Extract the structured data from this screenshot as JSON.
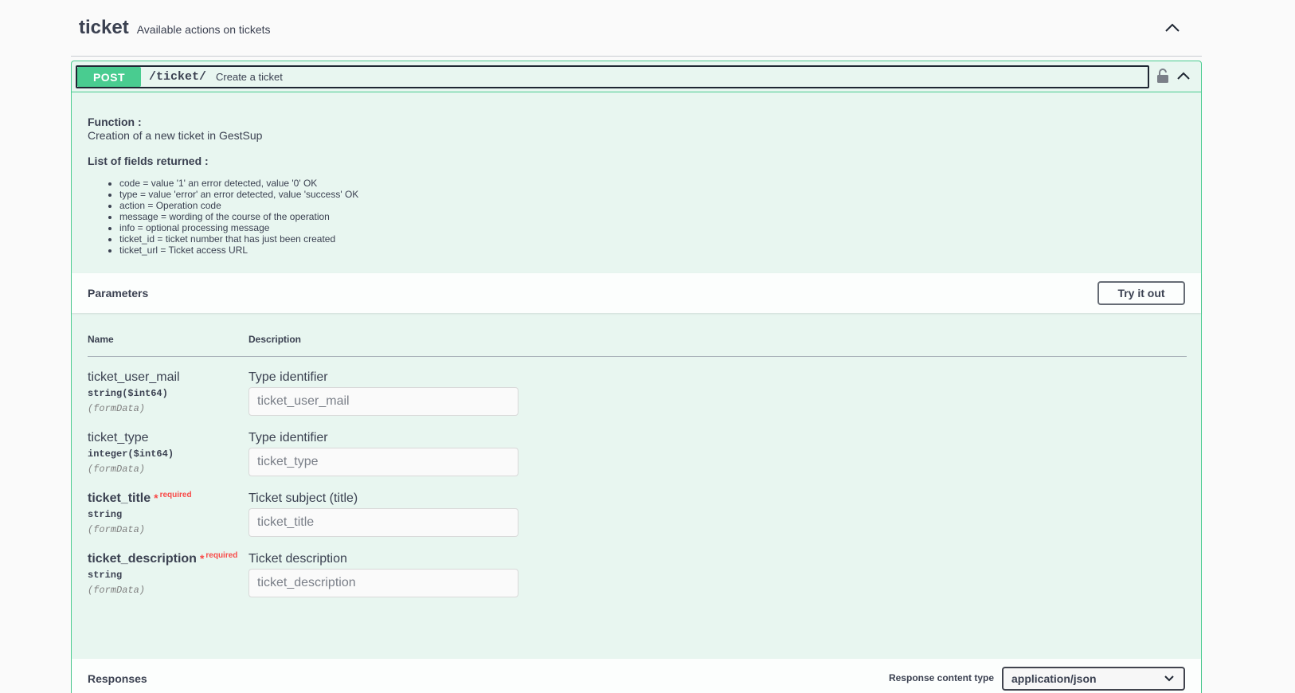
{
  "tag": {
    "name": "ticket",
    "description": "Available actions on tickets"
  },
  "operation": {
    "method": "POST",
    "path": "/ticket/",
    "summary": "Create a ticket",
    "function_label": "Function :",
    "function_text": "Creation of a new ticket in GestSup",
    "fields_heading": "List of fields returned :",
    "fields": [
      "code = value '1' an error detected, value '0' OK",
      "type = value 'error' an error detected, value 'success' OK",
      "action = Operation code",
      "message = wording of the course of the operation",
      "info = optional processing message",
      "ticket_id = ticket number that has just been created",
      "ticket_url = Ticket access URL"
    ]
  },
  "parameters": {
    "title": "Parameters",
    "try_label": "Try it out",
    "col_name": "Name",
    "col_description": "Description",
    "items": [
      {
        "name": "ticket_user_mail",
        "required": false,
        "type": "string",
        "format": "($int64)",
        "in": "(formData)",
        "description": "Type identifier",
        "placeholder": "ticket_user_mail"
      },
      {
        "name": "ticket_type",
        "required": false,
        "type": "integer",
        "format": "($int64)",
        "in": "(formData)",
        "description": "Type identifier",
        "placeholder": "ticket_type"
      },
      {
        "name": "ticket_title",
        "required": true,
        "type": "string",
        "format": "",
        "in": "(formData)",
        "description": "Ticket subject (title)",
        "placeholder": "ticket_title"
      },
      {
        "name": "ticket_description",
        "required": true,
        "type": "string",
        "format": "",
        "in": "(formData)",
        "description": "Ticket description",
        "placeholder": "ticket_description"
      }
    ],
    "required_star": "*",
    "required_text": "required"
  },
  "responses": {
    "title": "Responses",
    "content_type_label": "Response content type",
    "content_type_value": "application/json"
  },
  "colors": {
    "post": "#49cc90",
    "post_bg": "#e8f6f0",
    "text": "#3b4151",
    "required": "#ff0000"
  },
  "icons": {
    "tag_toggle": "chevron-up-icon",
    "lock": "lock-icon",
    "op_toggle": "chevron-up-icon",
    "select": "chevron-down-icon"
  }
}
